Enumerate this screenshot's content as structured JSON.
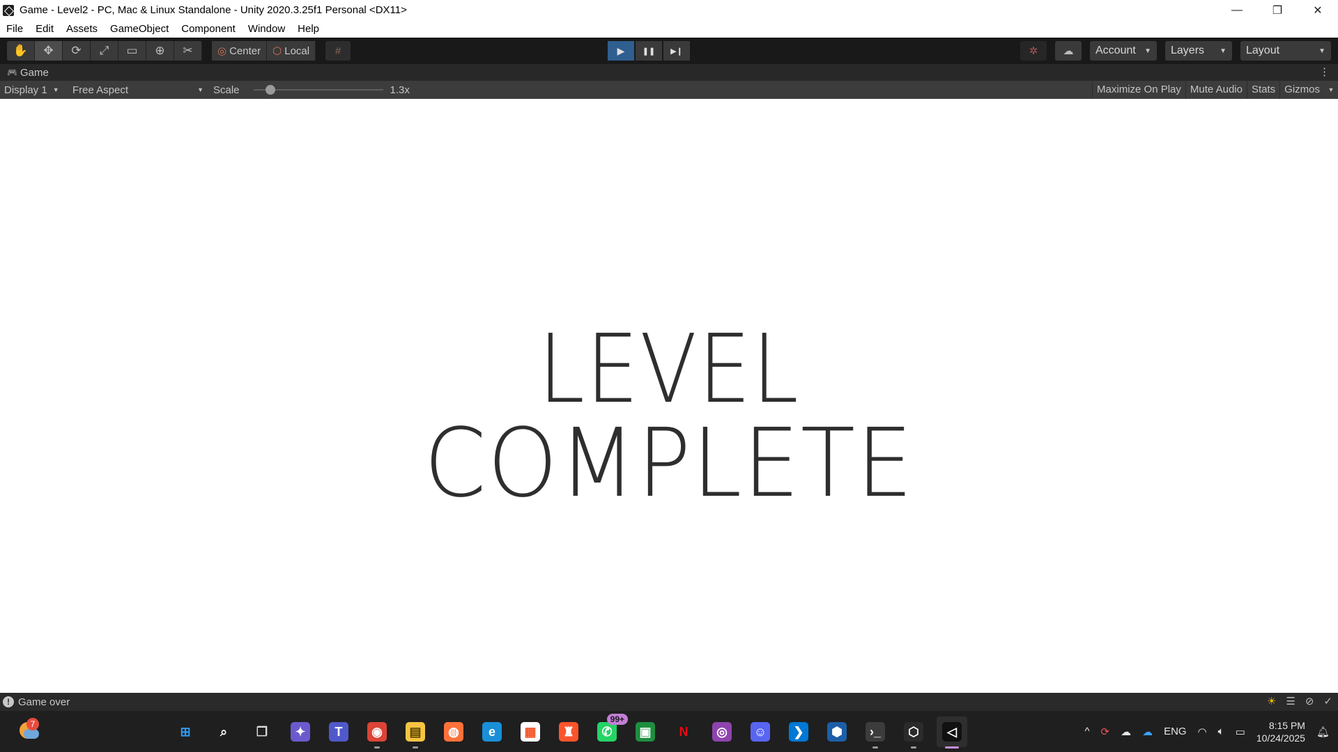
{
  "window": {
    "title": "Game - Level2 - PC, Mac & Linux Standalone - Unity 2020.3.25f1 Personal <DX11>",
    "minimize_glyph": "—",
    "maximize_glyph": "❐",
    "close_glyph": "✕"
  },
  "menu": [
    "File",
    "Edit",
    "Assets",
    "GameObject",
    "Component",
    "Window",
    "Help"
  ],
  "toolbar": {
    "tools": [
      {
        "name": "hand-tool-icon",
        "glyph": "✋"
      },
      {
        "name": "move-tool-icon",
        "glyph": "✥"
      },
      {
        "name": "rotate-tool-icon",
        "glyph": "⟳"
      },
      {
        "name": "scale-tool-icon",
        "glyph": "⤢"
      },
      {
        "name": "rect-tool-icon",
        "glyph": "▭"
      },
      {
        "name": "transform-tool-icon",
        "glyph": "⊕"
      },
      {
        "name": "custom-tool-icon",
        "glyph": "✂"
      }
    ],
    "pivot_label": "Center",
    "pivot_glyph": "◎",
    "space_label": "Local",
    "space_glyph": "⬡",
    "snap_glyph": "#",
    "play_glyph": "▶",
    "pause_glyph": "❚❚",
    "step_glyph": "▶❙",
    "collab_glyph": "✲",
    "cloud_glyph": "☁",
    "account_label": "Account",
    "layers_label": "Layers",
    "layout_label": "Layout",
    "caret": "▼"
  },
  "game_tab": {
    "label": "Game",
    "icon_glyph": "🎮",
    "kebab": "⋮"
  },
  "game_bar": {
    "display": "Display 1",
    "aspect": "Free Aspect",
    "scale_label": "Scale",
    "scale_value": "1.3x",
    "scale_fraction": 0.13,
    "maximize_on_play": "Maximize On Play",
    "mute_audio": "Mute Audio",
    "stats": "Stats",
    "gizmos": "Gizmos",
    "caret": "▼"
  },
  "game_view": {
    "line1": "LEVEL",
    "line2": "COMPLETE"
  },
  "status": {
    "message": "Game over",
    "info_glyph": "!",
    "icons": [
      "☀",
      "☰",
      "⊘",
      "✓"
    ]
  },
  "taskbar": {
    "weather_badge": "7",
    "apps": [
      {
        "name": "start-icon",
        "glyph": "⊞",
        "color": "#2f9bf0",
        "bg": "transparent"
      },
      {
        "name": "search-icon",
        "glyph": "⌕",
        "color": "#ffffff",
        "bg": "transparent"
      },
      {
        "name": "task-view-icon",
        "glyph": "❐",
        "color": "#dddddd",
        "bg": "transparent"
      },
      {
        "name": "copilot-icon",
        "glyph": "✦",
        "color": "#ffffff",
        "bg": "#6a5acd"
      },
      {
        "name": "teams-icon",
        "glyph": "T",
        "color": "#ffffff",
        "bg": "#5059c9"
      },
      {
        "name": "chrome-icon",
        "glyph": "◉",
        "color": "#ffffff",
        "bg": "#db4437"
      },
      {
        "name": "file-explorer-icon",
        "glyph": "▤",
        "color": "#5a4300",
        "bg": "#f5c542"
      },
      {
        "name": "firefox-icon",
        "glyph": "◍",
        "color": "#ffffff",
        "bg": "#ff7139"
      },
      {
        "name": "edge-icon",
        "glyph": "e",
        "color": "#ffffff",
        "bg": "#1a8fd8"
      },
      {
        "name": "store-icon",
        "glyph": "▦",
        "color": "#f25022",
        "bg": "#ffffff"
      },
      {
        "name": "brave-icon",
        "glyph": "♜",
        "color": "#ffffff",
        "bg": "#fb542b"
      },
      {
        "name": "whatsapp-icon",
        "glyph": "✆",
        "color": "#ffffff",
        "bg": "#25d366"
      },
      {
        "name": "classroom-icon",
        "glyph": "▣",
        "color": "#ffffff",
        "bg": "#1e8e3e"
      },
      {
        "name": "netflix-icon",
        "glyph": "N",
        "color": "#e50914",
        "bg": "transparent"
      },
      {
        "name": "podcast-icon",
        "glyph": "◎",
        "color": "#ffffff",
        "bg": "#8e44ad"
      },
      {
        "name": "discord-icon",
        "glyph": "☺",
        "color": "#ffffff",
        "bg": "#5865f2"
      },
      {
        "name": "vscode-icon",
        "glyph": "❯",
        "color": "#ffffff",
        "bg": "#0078d4"
      },
      {
        "name": "virtualbox-icon",
        "glyph": "⬢",
        "color": "#ffffff",
        "bg": "#1c5fa8"
      },
      {
        "name": "terminal-icon",
        "glyph": "›_",
        "color": "#ffffff",
        "bg": "#3c3c3c"
      },
      {
        "name": "unity-hub-icon",
        "glyph": "⬡",
        "color": "#ffffff",
        "bg": "#2b2b2b"
      },
      {
        "name": "unity-editor-icon",
        "glyph": "◁",
        "color": "#ffffff",
        "bg": "#111111"
      }
    ],
    "whatsapp_badge": "99+",
    "tray": {
      "chevron": "^",
      "language": "ENG",
      "time": "8:15 PM",
      "date": "10/24/2025"
    }
  }
}
